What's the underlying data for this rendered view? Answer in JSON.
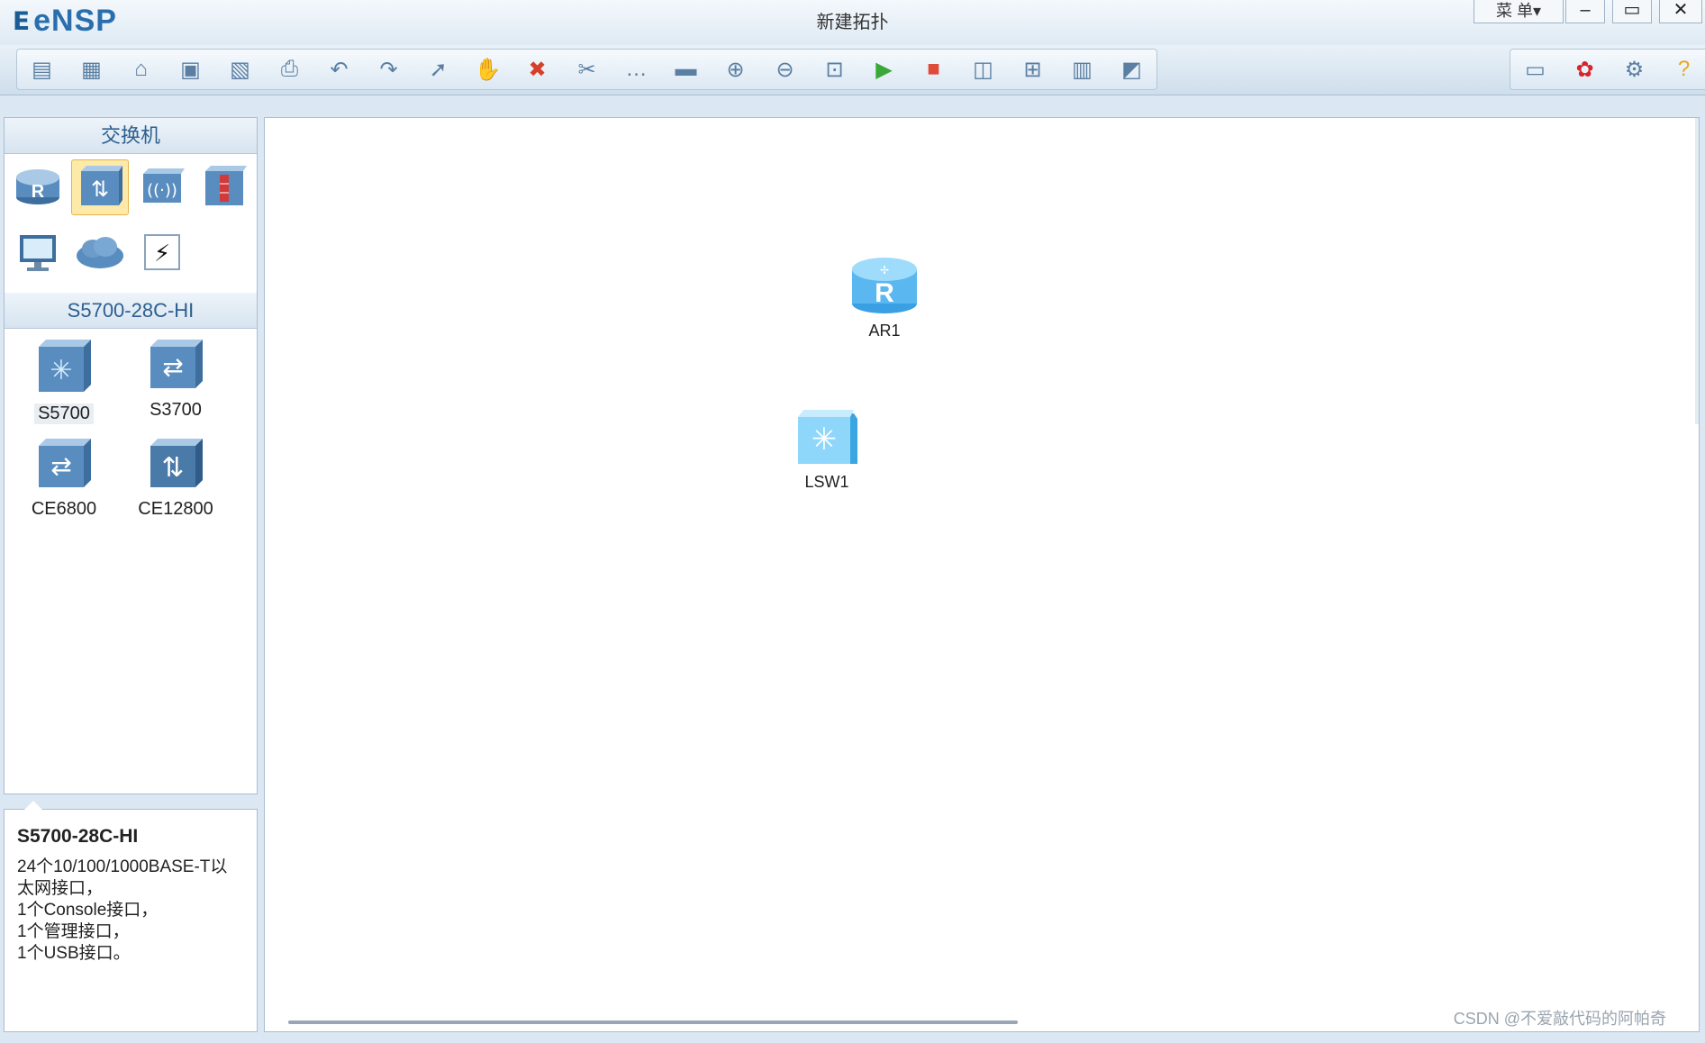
{
  "app": {
    "name": "eNSP",
    "window_title": "新建拓扑"
  },
  "window_controls": {
    "menu_label": "菜 单▾",
    "minimize": "–",
    "maximize": "▭",
    "close": "✕"
  },
  "toolbar": {
    "left_buttons": [
      {
        "name": "new-topology-icon",
        "glyph": "▤"
      },
      {
        "name": "new-lab-icon",
        "glyph": "▦"
      },
      {
        "name": "open-icon",
        "glyph": "⌂"
      },
      {
        "name": "save-icon",
        "glyph": "▣"
      },
      {
        "name": "save-as-icon",
        "glyph": "▧"
      },
      {
        "name": "print-icon",
        "glyph": "⎙"
      },
      {
        "name": "undo-icon",
        "glyph": "↶"
      },
      {
        "name": "redo-icon",
        "glyph": "↷"
      },
      {
        "name": "select-icon",
        "glyph": "➚"
      },
      {
        "name": "hand-icon",
        "glyph": "✋"
      },
      {
        "name": "delete-icon",
        "glyph": "✖"
      },
      {
        "name": "delete-link-icon",
        "glyph": "✂"
      },
      {
        "name": "text-note-icon",
        "glyph": "…"
      },
      {
        "name": "rectangle-icon",
        "glyph": "▬"
      },
      {
        "name": "zoom-in-icon",
        "glyph": "⊕"
      },
      {
        "name": "zoom-out-icon",
        "glyph": "⊖"
      },
      {
        "name": "fit-icon",
        "glyph": "⊡"
      },
      {
        "name": "start-all-icon",
        "glyph": "▶"
      },
      {
        "name": "stop-all-icon",
        "glyph": "■"
      },
      {
        "name": "capture-icon",
        "glyph": "◫"
      },
      {
        "name": "topology-icon",
        "glyph": "⊞"
      },
      {
        "name": "grid-icon",
        "glyph": "▥"
      },
      {
        "name": "screenshot-icon",
        "glyph": "◩"
      }
    ],
    "right_buttons": [
      {
        "name": "chat-icon",
        "glyph": "▭"
      },
      {
        "name": "huawei-icon",
        "glyph": "✿"
      },
      {
        "name": "settings-icon",
        "glyph": "⚙"
      },
      {
        "name": "help-icon",
        "glyph": "?"
      }
    ],
    "colors": {
      "delete": "#d6402b",
      "start": "#38a838",
      "stop": "#e04a3a",
      "help": "#e9a61f",
      "huawei": "#d8242a"
    }
  },
  "device_panel": {
    "category_title": "交换机",
    "categories": [
      {
        "name": "router-category-icon",
        "selected": false
      },
      {
        "name": "switch-category-icon",
        "selected": true
      },
      {
        "name": "wireless-category-icon",
        "selected": false
      },
      {
        "name": "firewall-category-icon",
        "selected": false
      },
      {
        "name": "pc-category-icon",
        "selected": false
      },
      {
        "name": "cloud-category-icon",
        "selected": false
      },
      {
        "name": "connection-category-icon",
        "selected": false
      }
    ],
    "model_title": "S5700-28C-HI",
    "models": [
      {
        "label": "S5700",
        "selected": true
      },
      {
        "label": "S3700",
        "selected": false
      },
      {
        "label": "CE6800",
        "selected": false
      },
      {
        "label": "CE12800",
        "selected": false
      }
    ]
  },
  "description": {
    "title": "S5700-28C-HI",
    "lines": [
      "24个10/100/1000BASE-T以",
      "太网接口，",
      "1个Console接口，",
      "1个管理接口，",
      "1个USB接口。"
    ]
  },
  "canvas": {
    "nodes": [
      {
        "label": "AR1",
        "type": "router"
      },
      {
        "label": "LSW1",
        "type": "switch"
      }
    ]
  },
  "watermark": "CSDN @不爱敲代码的阿帕奇"
}
